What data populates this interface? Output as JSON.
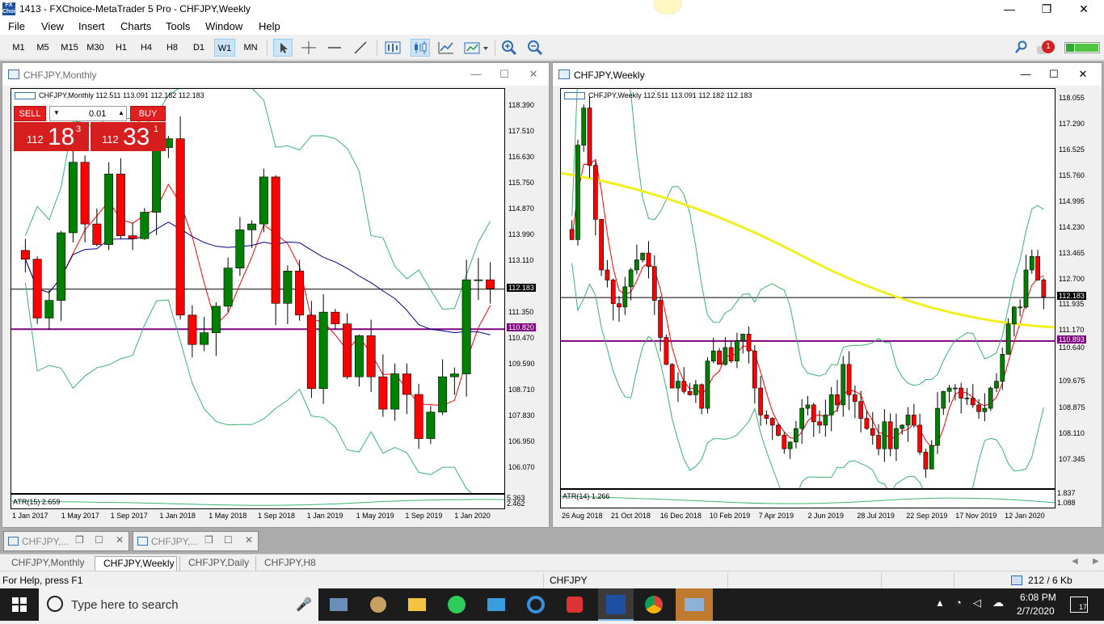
{
  "app": {
    "title": "1413 - FXChoice-MetaTrader 5 Pro - CHFJPY,Weekly",
    "logo_text": "FX Choice"
  },
  "menu": [
    "File",
    "View",
    "Insert",
    "Charts",
    "Tools",
    "Window",
    "Help"
  ],
  "toolbar": {
    "timeframes": [
      "M1",
      "M5",
      "M15",
      "M30",
      "H1",
      "H4",
      "H8",
      "D1",
      "W1",
      "MN"
    ],
    "active": "W1",
    "notification_count": "1"
  },
  "monthly": {
    "window_title": "CHFJPY,Monthly",
    "header": "CHFJPY,Monthly  112.511 113.091 112.182 112.183",
    "trade": {
      "sell": "SELL",
      "buy": "BUY",
      "lot": "0.01",
      "sell_big": "112",
      "sell_price": "18",
      "sell_sup": "3",
      "buy_big": "112",
      "buy_price": "33",
      "buy_sup": "1"
    },
    "price_labels": [
      "118.390",
      "117.510",
      "116.630",
      "115.750",
      "114.870",
      "113.990",
      "113.110",
      "112.183",
      "111.350",
      "110.820",
      "110.470",
      "109.590",
      "108.710",
      "107.830",
      "106.950",
      "106.070"
    ],
    "current": "112.183",
    "hline": "110.820",
    "indicator": "ATR(15) 2.659",
    "ind_axis": [
      "5.363",
      "2.462"
    ],
    "time_labels": [
      "1 Jan 2017",
      "1 May 2017",
      "1 Sep 2017",
      "1 Jan 2018",
      "1 May 2018",
      "1 Sep 2018",
      "1 Jan 2019",
      "1 May 2019",
      "1 Sep 2019",
      "1 Jan 2020"
    ]
  },
  "weekly": {
    "window_title": "CHFJPY,Weekly",
    "header": "CHFJPY,Weekly  112.511 113.091 112.182 112.183",
    "price_labels": [
      "118.055",
      "117.290",
      "116.525",
      "115.760",
      "114.995",
      "114.230",
      "113.465",
      "112.700",
      "112.183",
      "111.935",
      "111.170",
      "110.893",
      "110.640",
      "109.675",
      "108.875",
      "108.110",
      "107.345"
    ],
    "current": "112.183",
    "hline": "110.893",
    "indicator": "ATR(14) 1.266",
    "ind_axis": [
      "1.837",
      "1.088"
    ],
    "time_labels": [
      "26 Aug 2018",
      "21 Oct 2018",
      "16 Dec 2018",
      "10 Feb 2019",
      "7 Apr 2019",
      "2 Jun 2019",
      "28 Jul 2019",
      "22 Sep 2019",
      "17 Nov 2019",
      "12 Jan 2020"
    ]
  },
  "minimized": [
    "CHFJPY,...",
    "CHFJPY,..."
  ],
  "tabs": [
    "CHFJPY,Monthly",
    "CHFJPY,Weekly",
    "CHFJPY,Daily",
    "CHFJPY,H8"
  ],
  "active_tab": "CHFJPY,Weekly",
  "status": {
    "help": "For Help, press F1",
    "symbol": "CHFJPY",
    "traffic": "212 / 6 Kb"
  },
  "taskbar": {
    "search_placeholder": "Type here to search",
    "time": "6:08 PM",
    "date": "2/7/2020",
    "notif": "17"
  },
  "colors": {
    "bull": "#008000",
    "bear": "#ff0000",
    "bands": "#3cb371",
    "ma_red": "#ff0000",
    "ma_blue": "#00008b",
    "ma_yellow": "#f0f020",
    "hline": "#800080"
  }
}
